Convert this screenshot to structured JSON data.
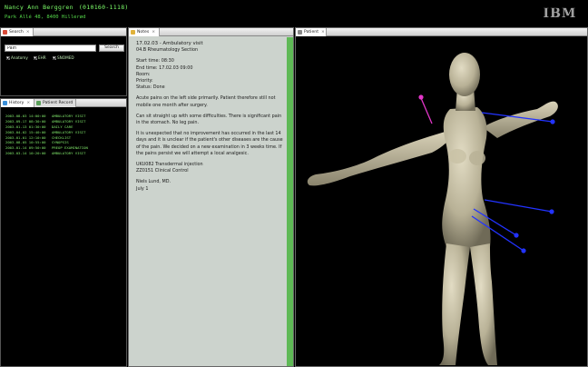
{
  "header": {
    "patient_name": "Nancy Ann Berggren",
    "patient_id": "(010160-1118)",
    "address": "Park Allé 48, 8400 Hillerød",
    "logo_text": "IBM"
  },
  "colors": {
    "terminal_green": "#7dff6a",
    "notes_background": "#ccd3cd",
    "notes_scrollbar": "#5fb956",
    "marker_blue": "#2233ff",
    "marker_pink": "#e236c8"
  },
  "search": {
    "tab_label": "Search",
    "input_value": "Pain",
    "button_label": "Search",
    "filters": [
      "Anatomy",
      "EHR",
      "SNOMED"
    ]
  },
  "history": {
    "tabs": [
      "History",
      "Patient Record"
    ],
    "rows": [
      {
        "date": "2003-08-03 14:00:00",
        "type": "AMBULATORY VISIT"
      },
      {
        "date": "2003-09-17 08:30:00",
        "type": "AMBULATORY VISIT"
      },
      {
        "date": "2003-01-13 01:30:00",
        "type": "DAILY CARE"
      },
      {
        "date": "2003-04-02 15:40:00",
        "type": "AMBULATORY VISIT"
      },
      {
        "date": "2003-01-01 12:10:00",
        "type": "CHECKLIST"
      },
      {
        "date": "2003-08-05 10:55:00",
        "type": "SYNOPSIS"
      },
      {
        "date": "2003-01-14 09:50:00",
        "type": "PREOP EXAMINATION"
      },
      {
        "date": "2003-03-14 10:20:00",
        "type": "AMBULATORY VISIT"
      }
    ]
  },
  "notes": {
    "tab_label": "Notes",
    "heading": "17.02.03 - Ambulatory visit",
    "department": "04.B Rheumatology Section",
    "start_time": "Start time: 08:30",
    "end_time": "End time: 17.02.03 09:00",
    "room": "Room:",
    "priority": "Priority:",
    "status": "Status: Done",
    "paragraph1": "Acute pains on the left side primarily. Patient therefore still not mobile one month after surgery.",
    "paragraph2": "Can sit straight up with some difficulties. There is significant pain in the stomach. No leg pain.",
    "paragraph3": "It is unexpected that no improvement has occurred in the last 14 days and it is unclear if the patient's other diseases are the cause of the pain. We decided on a new examination in 3 weeks time. If the pains persist we will attempt a local analgesic.",
    "code1": "UKU082  Transdermal injection",
    "code2": "ZZ0151  Clinical Control",
    "signature_name": "Niels Lund, MD.",
    "signature_date": "July 1"
  },
  "patient_view": {
    "tab_label": "Patient"
  }
}
